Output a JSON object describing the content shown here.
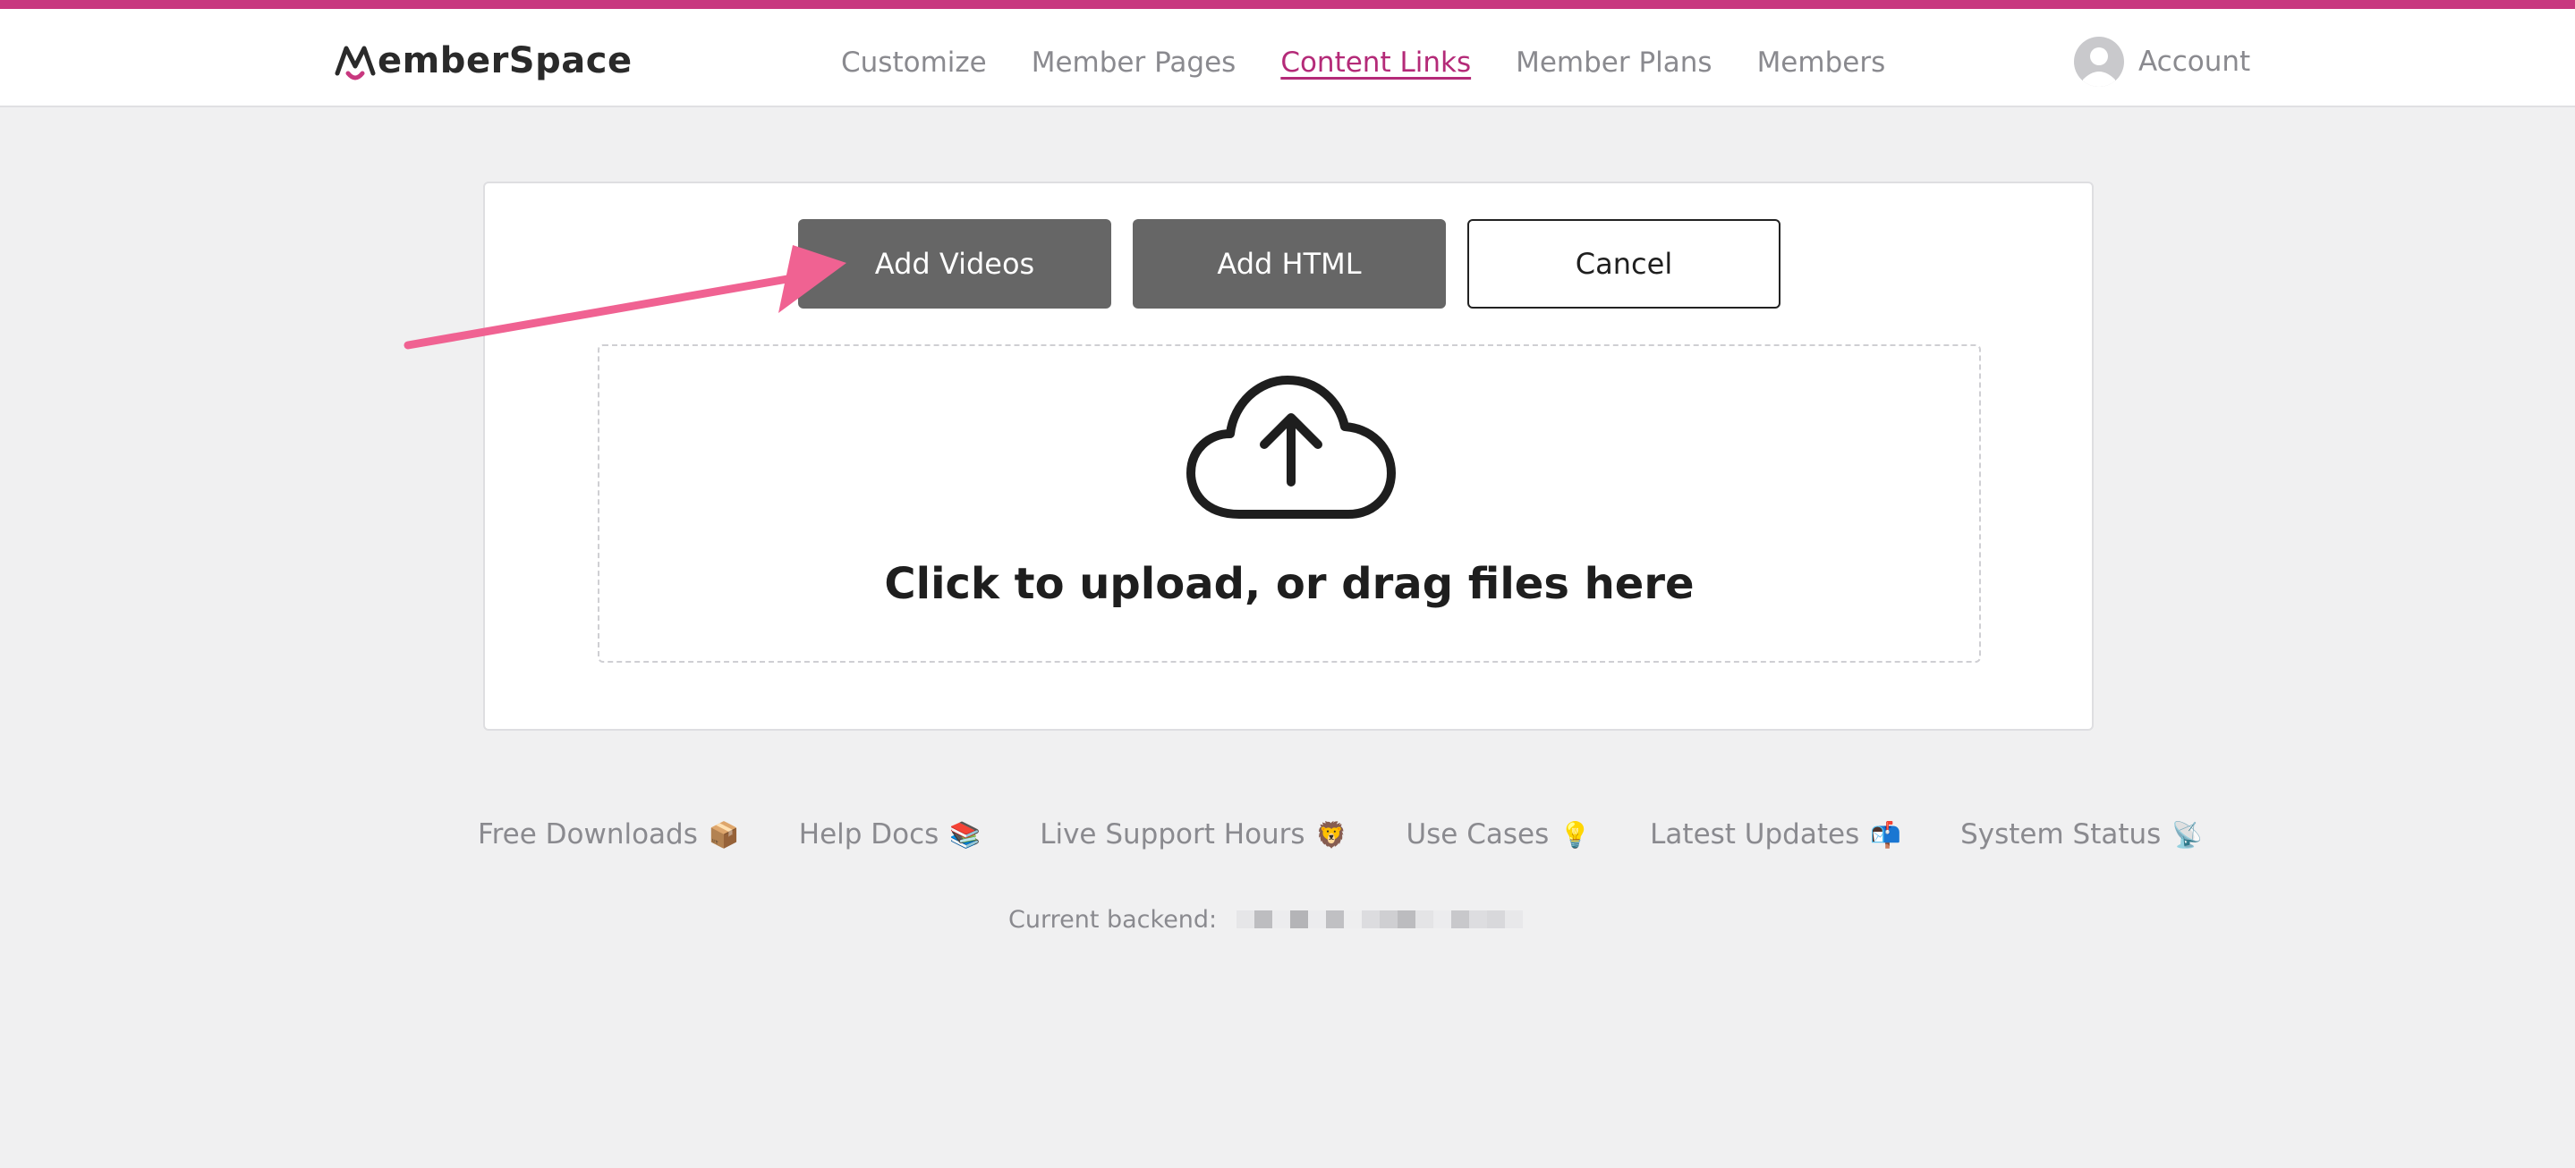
{
  "colors": {
    "accent": "#c8387f",
    "arrow": "#f06292",
    "nav_active": "#b42a78"
  },
  "brand": {
    "name": "MemberSpace",
    "name_rest": "emberSpace"
  },
  "nav": {
    "items": [
      {
        "label": "Customize",
        "active": false
      },
      {
        "label": "Member Pages",
        "active": false
      },
      {
        "label": "Content Links",
        "active": true
      },
      {
        "label": "Member Plans",
        "active": false
      },
      {
        "label": "Members",
        "active": false
      }
    ],
    "account_label": "Account",
    "account_icon": "user-avatar-icon"
  },
  "actions": {
    "add_videos": "Add Videos",
    "add_html": "Add HTML",
    "cancel": "Cancel"
  },
  "upload": {
    "icon": "cloud-upload-icon",
    "text": "Click to upload, or drag files here"
  },
  "footer": {
    "links": [
      {
        "label": "Free Downloads",
        "emoji": "📦"
      },
      {
        "label": "Help Docs",
        "emoji": "📚"
      },
      {
        "label": "Live Support Hours",
        "emoji": "🦁"
      },
      {
        "label": "Use Cases",
        "emoji": "💡"
      },
      {
        "label": "Latest Updates",
        "emoji": "📬"
      },
      {
        "label": "System Status",
        "emoji": "📡"
      }
    ],
    "backend_label": "Current backend:"
  }
}
